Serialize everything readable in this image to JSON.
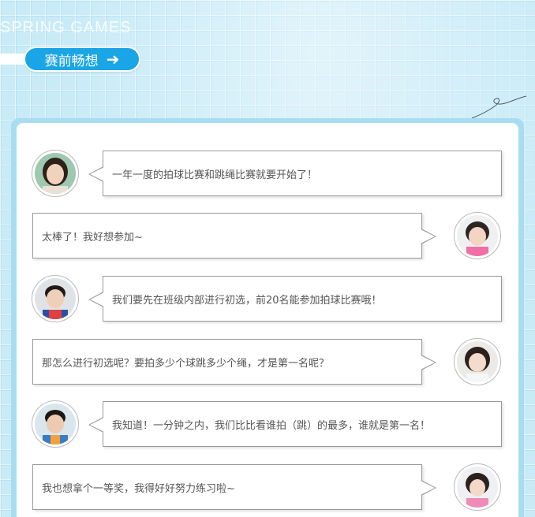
{
  "header": {
    "english_title": "SPRING GAMES",
    "section_button_label": "赛前畅想",
    "section_button_icon": "arrow-right-icon"
  },
  "colors": {
    "accent": "#1aa6e6",
    "background": "#c9ebf7",
    "card_frame": "#a8dcf1",
    "text": "#555555"
  },
  "conversation": [
    {
      "speaker": "teacher",
      "side": "left",
      "avatar_icon": "teacher-avatar",
      "text": "一年一度的拍球比赛和跳绳比赛就要开始了！"
    },
    {
      "speaker": "girl-1",
      "side": "right",
      "avatar_icon": "girl-avatar",
      "text": "太棒了！我好想参加~"
    },
    {
      "speaker": "boy-1",
      "side": "left",
      "avatar_icon": "boy-avatar",
      "text": "我们要先在班级内部进行初选，前20名能参加拍球比赛哦！"
    },
    {
      "speaker": "girl-2",
      "side": "right",
      "avatar_icon": "girl-avatar",
      "text": "那怎么进行初选呢？要拍多少个球跳多少个绳，才是第一名呢？"
    },
    {
      "speaker": "boy-2",
      "side": "left",
      "avatar_icon": "boy-avatar",
      "text": "我知道！一分钟之内，我们比比看谁拍（跳）的最多，谁就是第一名！"
    },
    {
      "speaker": "girl-3",
      "side": "right",
      "avatar_icon": "girl-avatar",
      "text": "我也想拿个一等奖，我得好好努力练习啦~"
    }
  ]
}
